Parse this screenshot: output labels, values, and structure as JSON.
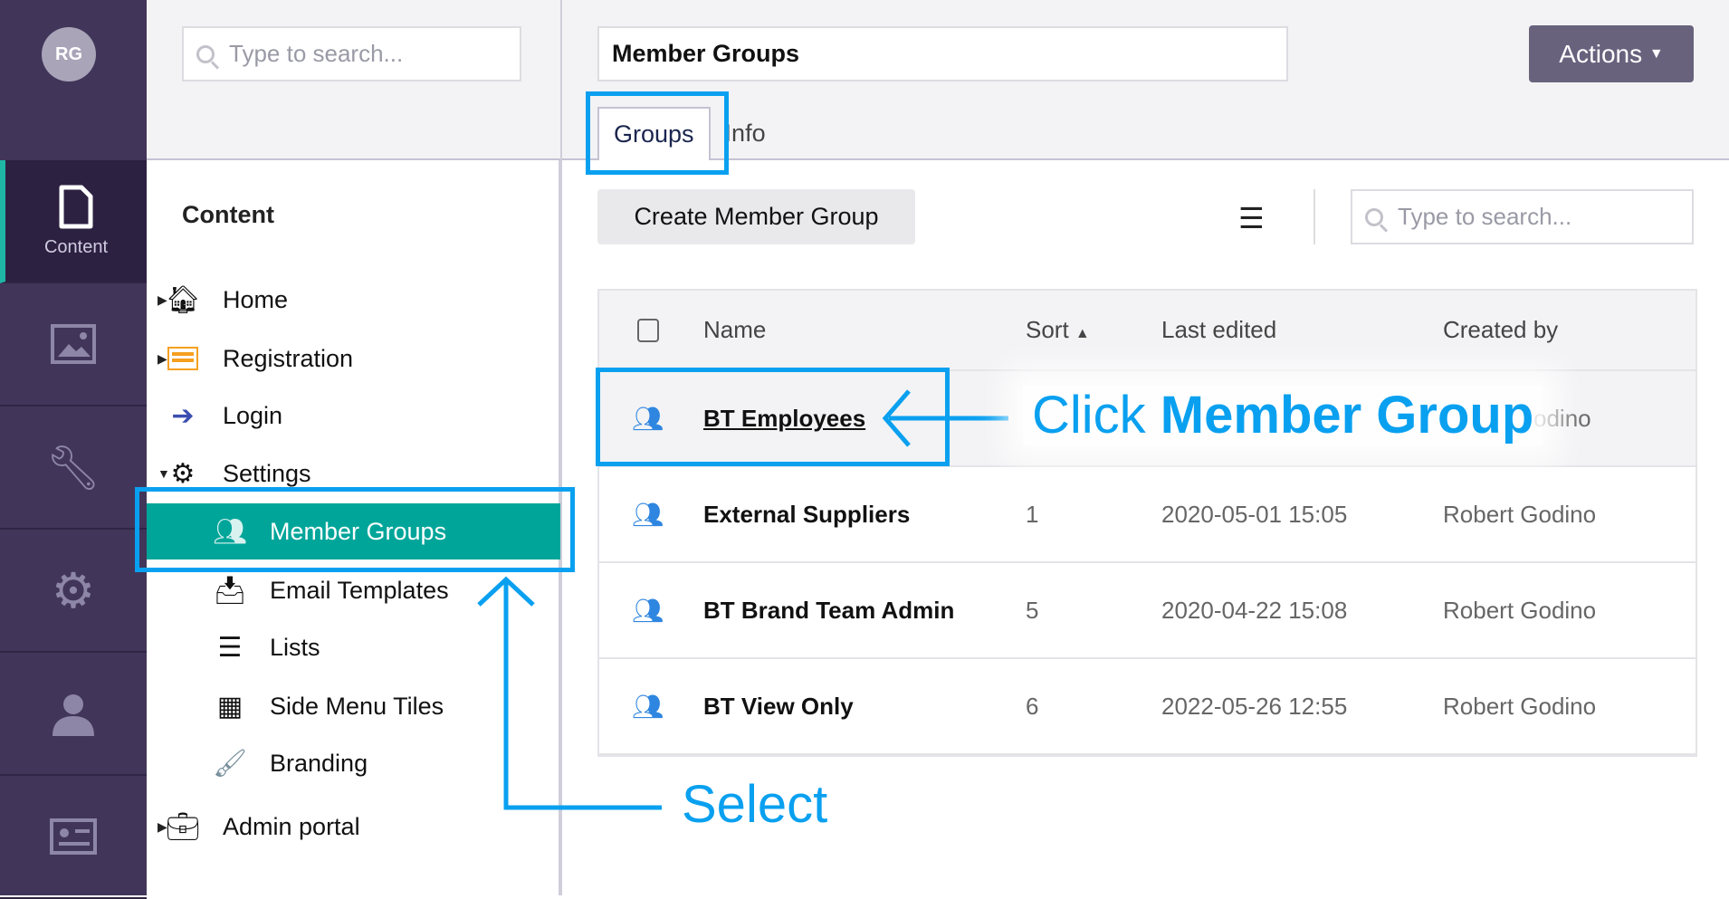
{
  "nav": {
    "avatar": "RG",
    "items": [
      {
        "label": "Content",
        "icon": "document-icon"
      },
      {
        "icon": "image-icon"
      },
      {
        "icon": "wrench-icon"
      },
      {
        "icon": "gear-icon"
      },
      {
        "icon": "user-icon"
      },
      {
        "icon": "id-card-icon"
      }
    ]
  },
  "tree": {
    "search_placeholder": "Type to search...",
    "title": "Content",
    "items": [
      {
        "label": "Home"
      },
      {
        "label": "Registration"
      },
      {
        "label": "Login"
      },
      {
        "label": "Settings"
      },
      {
        "label": "Member Groups"
      },
      {
        "label": "Email Templates"
      },
      {
        "label": "Lists"
      },
      {
        "label": "Side Menu Tiles"
      },
      {
        "label": "Branding"
      },
      {
        "label": "Admin portal"
      }
    ]
  },
  "header": {
    "name_value": "Member Groups",
    "actions_label": "Actions",
    "tabs": [
      "Groups",
      "Info"
    ]
  },
  "toolbar": {
    "create_label": "Create Member Group",
    "search_placeholder": "Type to search..."
  },
  "table": {
    "columns": [
      "Name",
      "Sort",
      "Last edited",
      "Created by"
    ],
    "rows": [
      {
        "name": "BT Employees",
        "sort": "",
        "edited": "",
        "by": "odino"
      },
      {
        "name": "External Suppliers",
        "sort": "1",
        "edited": "2020-05-01 15:05",
        "by": "Robert Godino"
      },
      {
        "name": "BT Brand Team Admin",
        "sort": "5",
        "edited": "2020-04-22 15:08",
        "by": "Robert Godino"
      },
      {
        "name": "BT View Only",
        "sort": "6",
        "edited": "2022-05-26 12:55",
        "by": "Robert Godino"
      }
    ]
  },
  "annotations": {
    "click_prefix": "Click",
    "click_bold": "Member Group",
    "select": "Select",
    "color": "#0aa0f0"
  }
}
